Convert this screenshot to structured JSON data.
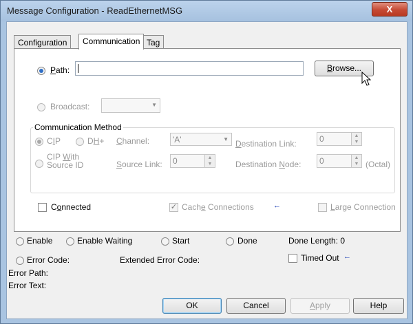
{
  "window": {
    "title": "Message Configuration - ReadEthernetMSG",
    "close_label": "X"
  },
  "tabs": [
    "Configuration",
    "Communication",
    "Tag"
  ],
  "path": {
    "label": "Path:",
    "value": "",
    "browse_label": "Browse..."
  },
  "broadcast": {
    "label": "Broadcast:",
    "value": ""
  },
  "comm_method": {
    "title": "Communication Method",
    "cip_label": "CIP",
    "dhplus_label": "DH+",
    "cip_source_line1": "CIP With",
    "cip_source_line2": "Source ID",
    "channel_label": "Channel:",
    "channel_value": "'A'",
    "dest_link_label": "Destination Link:",
    "dest_link_value": "0",
    "source_link_label": "Source Link:",
    "source_link_value": "0",
    "dest_node_label": "Destination Node:",
    "dest_node_value": "0",
    "octal_label": "(Octal)"
  },
  "options": {
    "connected_label": "Connected",
    "cache_label": "Cache Connections",
    "large_label": "Large Connection"
  },
  "status": {
    "enable": "Enable",
    "enable_waiting": "Enable Waiting",
    "start": "Start",
    "done": "Done",
    "done_length": "Done Length: 0",
    "error_code": "Error Code:",
    "extended_error_code": "Extended Error Code:",
    "timed_out": "Timed Out",
    "error_path": "Error Path:",
    "error_text": "Error Text:"
  },
  "buttons": {
    "ok": "OK",
    "cancel": "Cancel",
    "apply": "Apply",
    "help": "Help"
  },
  "colors": {
    "title_bar": "#a9c4e1",
    "close_button": "#c64a34",
    "radio_checked": "#2f6fc6",
    "arrow_blue": "#1c3fb4"
  },
  "icons": {
    "close": "x-glyph",
    "cursor": "mouse-pointer-icon",
    "arrow": "left-arrow-icon"
  }
}
